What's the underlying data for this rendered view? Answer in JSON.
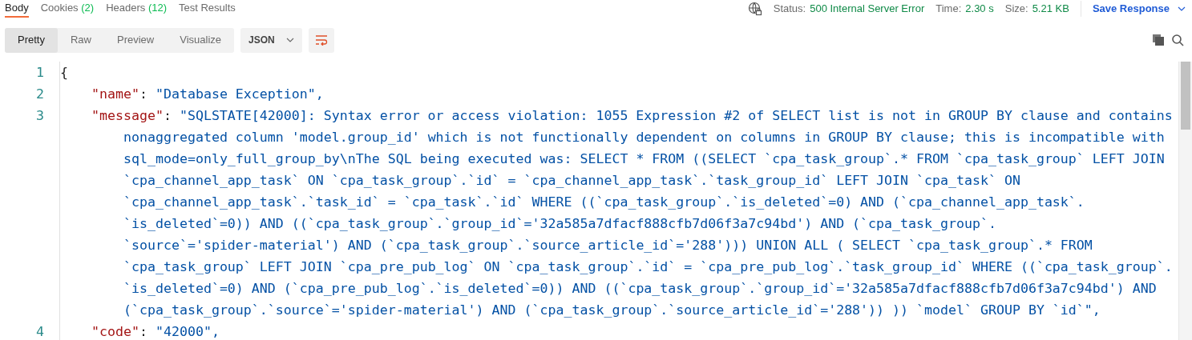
{
  "tabs": [
    {
      "label": "Body",
      "selected": true
    },
    {
      "label": "Cookies",
      "count": "(2)",
      "selected": false
    },
    {
      "label": "Headers",
      "count": "(12)",
      "selected": false
    },
    {
      "label": "Test Results",
      "selected": false
    }
  ],
  "status": [
    {
      "label": "Status:",
      "value": "500 Internal Server Error"
    },
    {
      "label": "Time:",
      "value": "2.30 s"
    },
    {
      "label": "Size:",
      "value": "5.21 KB"
    }
  ],
  "save_button": "Save Response",
  "view_modes": [
    {
      "label": "Pretty",
      "selected": true
    },
    {
      "label": "Raw",
      "selected": false
    },
    {
      "label": "Preview",
      "selected": false
    },
    {
      "label": "Visualize",
      "selected": false
    }
  ],
  "format_dropdown": "JSON",
  "wrap_lines": true,
  "code_lines": [
    {
      "number": "1",
      "kind": "punct",
      "text": "{"
    },
    {
      "number": "2",
      "kind": "pair",
      "key": "\"name\"",
      "separator": ":",
      "value_lines": [
        "\"Database Exception\","
      ]
    },
    {
      "number": "3",
      "kind": "pair",
      "key": "\"message\"",
      "separator": ":",
      "value_lines": [
        "\"SQLSTATE[42000]: Syntax error or access violation: 1055 Expression #2 of SELECT list is not in GROUP BY clause and contains",
        "nonaggregated column 'model.group_id' which is not functionally dependent on columns in GROUP BY clause; this is incompatible with",
        "sql_mode=only_full_group_by\\nThe SQL being executed was: SELECT * FROM ((SELECT `cpa_task_group`.* FROM `cpa_task_group` LEFT JOIN",
        "`cpa_channel_app_task` ON `cpa_task_group`.`id` = `cpa_channel_app_task`.`task_group_id` LEFT JOIN `cpa_task` ON",
        "`cpa_channel_app_task`.`task_id` = `cpa_task`.`id` WHERE ((`cpa_task_group`.`is_deleted`=0) AND (`cpa_channel_app_task`.",
        "`is_deleted`=0)) AND ((`cpa_task_group`.`group_id`='32a585a7dfacf888cfb7d06f3a7c94bd') AND (`cpa_task_group`.",
        "`source`='spider-material') AND (`cpa_task_group`.`source_article_id`='288'))) UNION ALL ( SELECT `cpa_task_group`.* FROM",
        "`cpa_task_group` LEFT JOIN `cpa_pre_pub_log` ON `cpa_task_group`.`id` = `cpa_pre_pub_log`.`task_group_id` WHERE ((`cpa_task_group`.",
        "`is_deleted`=0) AND (`cpa_pre_pub_log`.`is_deleted`=0)) AND ((`cpa_task_group`.`group_id`='32a585a7dfacf888cfb7d06f3a7c94bd') AND",
        "(`cpa_task_group`.`source`='spider-material') AND (`cpa_task_group`.`source_article_id`='288')) )) `model` GROUP BY `id`\","
      ]
    },
    {
      "number": "4",
      "kind": "pair",
      "key": "\"code\"",
      "separator": ":",
      "value_lines": [
        "\"42000\","
      ]
    }
  ]
}
